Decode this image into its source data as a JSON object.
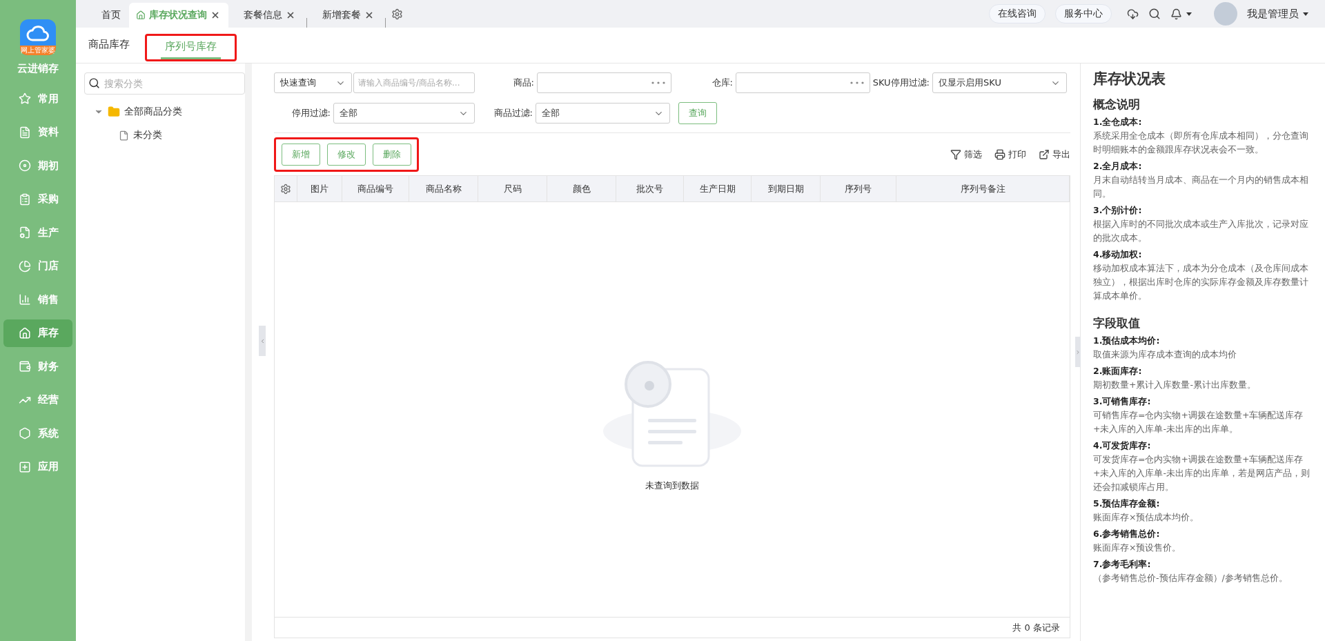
{
  "app": {
    "name": "云进销存",
    "logo_badge": "网上管家婆"
  },
  "nav": [
    {
      "label": "常用",
      "selected": false
    },
    {
      "label": "资料",
      "selected": false
    },
    {
      "label": "期初",
      "selected": false
    },
    {
      "label": "采购",
      "selected": false
    },
    {
      "label": "生产",
      "selected": false
    },
    {
      "label": "门店",
      "selected": false
    },
    {
      "label": "销售",
      "selected": false
    },
    {
      "label": "库存",
      "selected": true
    },
    {
      "label": "财务",
      "selected": false
    },
    {
      "label": "经营",
      "selected": false
    },
    {
      "label": "系统",
      "selected": false
    },
    {
      "label": "应用",
      "selected": false
    }
  ],
  "tabs": [
    {
      "label": "首页",
      "selected": false,
      "closable": false
    },
    {
      "label": "库存状况查询",
      "selected": true,
      "closable": true
    },
    {
      "label": "套餐信息",
      "selected": false,
      "closable": true
    },
    {
      "label": "新增套餐",
      "selected": false,
      "closable": true
    }
  ],
  "header": {
    "buttons": [
      "在线咨询",
      "服务中心"
    ],
    "user": "我是管理员"
  },
  "subtabs": [
    {
      "label": "商品库存",
      "selected": false
    },
    {
      "label": "序列号库存",
      "selected": true
    }
  ],
  "tree": {
    "search_placeholder": "搜索分类",
    "items": [
      {
        "label": "全部商品分类",
        "expanded": true,
        "children": [
          {
            "label": "未分类"
          }
        ]
      }
    ]
  },
  "filters": {
    "quick_mode": "快速查询",
    "quick_placeholder": "请输入商品编号/商品名称...",
    "product_label": "商品:",
    "warehouse_label": "仓库:",
    "sku_label": "SKU停用过滤:",
    "sku_value": "仅显示启用SKU",
    "disabled_label": "停用过滤:",
    "disabled_value": "全部",
    "product_filter_label": "商品过滤:",
    "product_filter_value": "全部",
    "query_button": "查询"
  },
  "actions": [
    "新增",
    "修改",
    "删除"
  ],
  "tools": [
    "筛选",
    "打印",
    "导出"
  ],
  "table": {
    "columns": [
      "图片",
      "商品编号",
      "商品名称",
      "尺码",
      "颜色",
      "批次号",
      "生产日期",
      "到期日期",
      "序列号",
      "序列号备注"
    ],
    "empty_text": "未查询到数据",
    "footer": "共 0 条记录"
  },
  "info": {
    "title": "库存状况表",
    "sections": [
      {
        "heading": "概念说明",
        "items": [
          {
            "term": "1.全仓成本:",
            "desc": "系统采用全仓成本（即所有仓库成本相同），分仓查询时明细账本的金额跟库存状况表会不一致。"
          },
          {
            "term": "2.全月成本:",
            "desc": "月末自动结转当月成本、商品在一个月内的销售成本相同。"
          },
          {
            "term": "3.个别计价:",
            "desc": "根据入库时的不同批次成本或生产入库批次，记录对应的批次成本。"
          },
          {
            "term": "4.移动加权:",
            "desc": "移动加权成本算法下，成本为分仓成本（及仓库间成本独立），根据出库时仓库的实际库存金额及库存数量计算成本单价。"
          }
        ]
      },
      {
        "heading": "字段取值",
        "items": [
          {
            "term": "1.预估成本均价:",
            "desc": "取值来源为库存成本查询的成本均价"
          },
          {
            "term": "2.账面库存:",
            "desc": "期初数量+累计入库数量-累计出库数量。"
          },
          {
            "term": "3.可销售库存:",
            "desc": "可销售库存=仓内实物+调拨在途数量+车辆配送库存+未入库的入库单-未出库的出库单。"
          },
          {
            "term": "4.可发货库存:",
            "desc": "可发货库存=仓内实物+调拨在途数量+车辆配送库存+未入库的入库单-未出库的出库单，若是网店产品，则还会扣减锁库占用。"
          },
          {
            "term": "5.预估库存金额:",
            "desc": "账面库存×预估成本均价。"
          },
          {
            "term": "6.参考销售总价:",
            "desc": "账面库存×预设售价。"
          },
          {
            "term": "7.参考毛利率:",
            "desc": "（参考销售总价-预估库存金额）/参考销售总价。"
          }
        ]
      }
    ]
  }
}
